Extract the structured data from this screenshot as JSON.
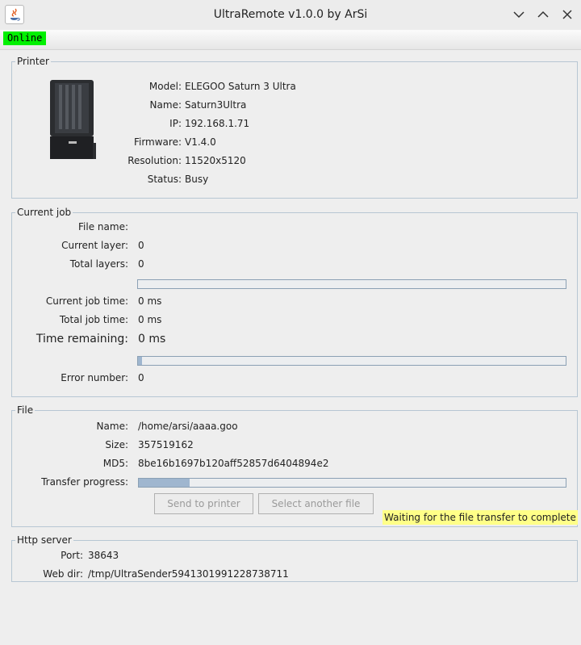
{
  "window": {
    "title": "UltraRemote v1.0.0 by ArSi",
    "status_badge": "Online"
  },
  "printer": {
    "section_title": "Printer",
    "image_label": "printer-photo",
    "fields": [
      {
        "label": "Model:",
        "value": "ELEGOO Saturn 3 Ultra"
      },
      {
        "label": "Name:",
        "value": "Saturn3Ultra"
      },
      {
        "label": "IP:",
        "value": "192.168.1.71"
      },
      {
        "label": "Firmware:",
        "value": "V1.4.0"
      },
      {
        "label": "Resolution:",
        "value": "11520x5120"
      },
      {
        "label": "Status:",
        "value": "Busy"
      }
    ]
  },
  "current_job": {
    "section_title": "Current job",
    "file_name_label": "File name:",
    "file_name_value": "",
    "current_layer_label": "Current layer:",
    "current_layer_value": "0",
    "total_layers_label": "Total layers:",
    "total_layers_value": "0",
    "layer_progress": 0,
    "current_job_time_label": "Current job time:",
    "current_job_time_value": "0 ms",
    "total_job_time_label": "Total job time:",
    "total_job_time_value": "0 ms",
    "time_remaining_label": "Time remaining:",
    "time_remaining_value": "0 ms",
    "time_progress": 0.01,
    "error_number_label": "Error number:",
    "error_number_value": "0"
  },
  "file": {
    "section_title": "File",
    "name_label": "Name:",
    "name_value": "/home/arsi/aaaa.goo",
    "size_label": "Size:",
    "size_value": "357519162",
    "md5_label": "MD5:",
    "md5_value": "8be16b1697b120aff52857d6404894e2",
    "transfer_label": "Transfer progress:",
    "transfer_progress": 0.12,
    "send_button": "Send to printer",
    "select_button": "Select another file",
    "waiting_message": "Waiting for the file transfer to complete"
  },
  "http_server": {
    "section_title": "Http server",
    "port_label": "Port:",
    "port_value": "38643",
    "webdir_label": "Web dir:",
    "webdir_value": "/tmp/UltraSender5941301991228738711"
  },
  "colors": {
    "online": "#00f000",
    "progress_fill": "#9fb6cf",
    "panel_border": "#b7c6d3",
    "waiting_bg": "#ffff88"
  }
}
